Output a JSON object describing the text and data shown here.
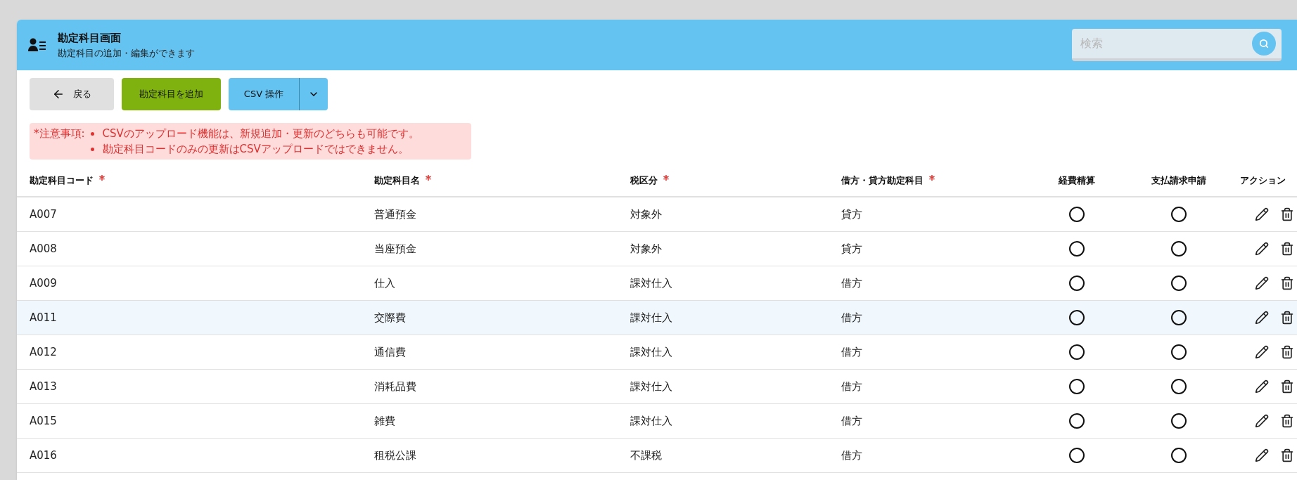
{
  "header": {
    "title": "勘定科目画面",
    "subtitle": "勘定科目の追加・編集ができます",
    "search": {
      "placeholder": "検索"
    }
  },
  "toolbar": {
    "back_button": "戻る",
    "add_button": "勘定科目を追加",
    "csv_button": "CSV 操作"
  },
  "notice": {
    "label": "*注意事項:",
    "items": [
      "CSVのアップロード機能は、新規追加・更新のどちらも可能です。",
      "勘定科目コードのみの更新はCSVアップロードではできません。"
    ]
  },
  "table": {
    "columns": [
      {
        "label": "勘定科目コード",
        "required": true
      },
      {
        "label": "勘定科目名",
        "required": true
      },
      {
        "label": "税区分",
        "required": true
      },
      {
        "label": "借方・貸方勘定科目",
        "required": true
      },
      {
        "label": "経費精算",
        "required": false
      },
      {
        "label": "支払請求申請",
        "required": false
      },
      {
        "label": "アクション",
        "required": false
      }
    ],
    "rows": [
      {
        "code": "A007",
        "name": "普通預金",
        "tax": "対象外",
        "side": "貸方",
        "expense": true,
        "payment": true,
        "selected": false
      },
      {
        "code": "A008",
        "name": "当座預金",
        "tax": "対象外",
        "side": "貸方",
        "expense": true,
        "payment": true,
        "selected": false
      },
      {
        "code": "A009",
        "name": "仕入",
        "tax": "課対仕入",
        "side": "借方",
        "expense": true,
        "payment": true,
        "selected": false
      },
      {
        "code": "A011",
        "name": "交際費",
        "tax": "課対仕入",
        "side": "借方",
        "expense": true,
        "payment": true,
        "selected": true
      },
      {
        "code": "A012",
        "name": "通信費",
        "tax": "課対仕入",
        "side": "借方",
        "expense": true,
        "payment": true,
        "selected": false
      },
      {
        "code": "A013",
        "name": "消耗品費",
        "tax": "課対仕入",
        "side": "借方",
        "expense": true,
        "payment": true,
        "selected": false
      },
      {
        "code": "A015",
        "name": "雑費",
        "tax": "課対仕入",
        "side": "借方",
        "expense": true,
        "payment": true,
        "selected": false
      },
      {
        "code": "A016",
        "name": "租税公課",
        "tax": "不課税",
        "side": "借方",
        "expense": true,
        "payment": true,
        "selected": false
      }
    ]
  }
}
